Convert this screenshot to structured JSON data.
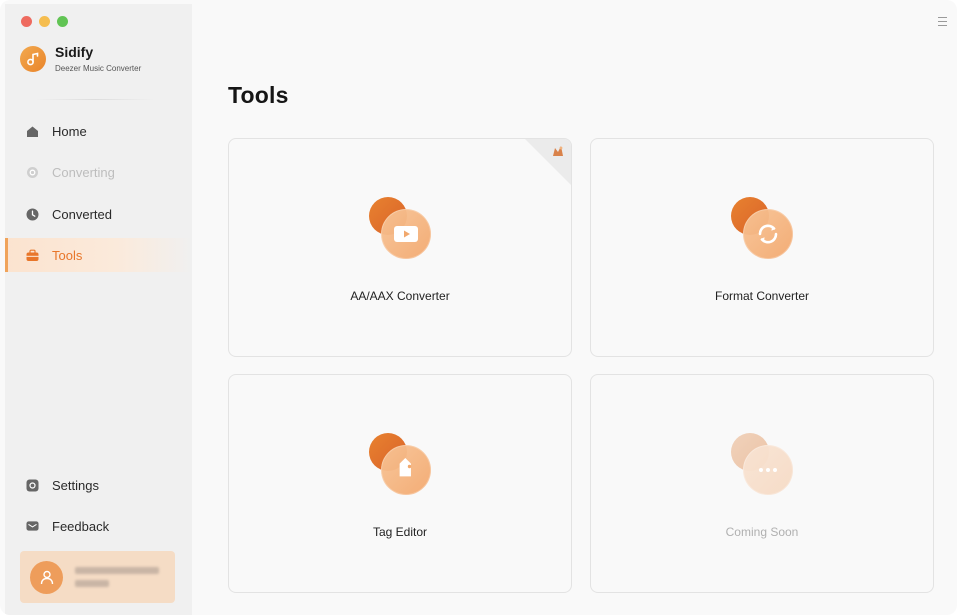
{
  "app": {
    "name": "Sidify",
    "subtitle": "Deezer Music Converter"
  },
  "sidebar": {
    "items": [
      {
        "label": "Home",
        "icon": "home-icon",
        "state": "normal"
      },
      {
        "label": "Converting",
        "icon": "converting-icon",
        "state": "disabled"
      },
      {
        "label": "Converted",
        "icon": "clock-icon",
        "state": "normal"
      },
      {
        "label": "Tools",
        "icon": "toolbox-icon",
        "state": "active"
      }
    ],
    "bottom_items": [
      {
        "label": "Settings",
        "icon": "gear-icon"
      },
      {
        "label": "Feedback",
        "icon": "mail-icon"
      }
    ]
  },
  "main": {
    "title": "Tools",
    "tools": [
      {
        "label": "AA/AAX Converter",
        "icon": "video-play-icon",
        "badge": "premium-corner-icon",
        "enabled": true
      },
      {
        "label": "Format Converter",
        "icon": "refresh-icon",
        "enabled": true
      },
      {
        "label": "Tag Editor",
        "icon": "tag-icon",
        "enabled": true
      },
      {
        "label": "Coming Soon",
        "icon": "more-dots-icon",
        "enabled": false
      }
    ]
  },
  "colors": {
    "accent": "#e8762a",
    "active_bg": "#fbe3cf",
    "sidebar_bg": "#f0f0f0",
    "main_bg": "#f9f9f9"
  }
}
